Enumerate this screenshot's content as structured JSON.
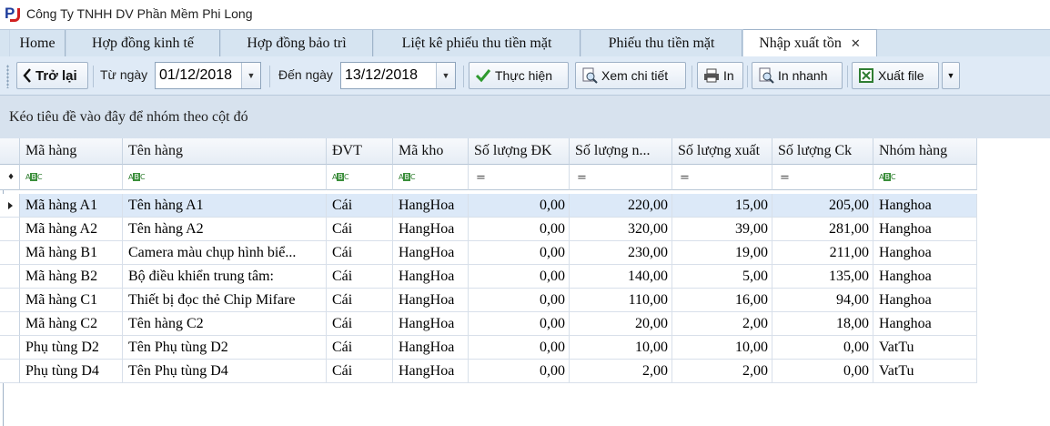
{
  "window": {
    "title": "Công Ty TNHH DV Phần Mềm Phi Long"
  },
  "tabs": [
    {
      "label": "Home"
    },
    {
      "label": "Hợp đồng kinh tế"
    },
    {
      "label": "Hợp đồng bảo trì"
    },
    {
      "label": "Liệt kê phiếu thu tiền mặt"
    },
    {
      "label": "Phiếu thu tiền mặt"
    },
    {
      "label": "Nhập xuất tồn",
      "active": true
    }
  ],
  "toolbar": {
    "back_label": "Trở lại",
    "from_label": "Từ ngày",
    "from_value": "01/12/2018",
    "to_label": "Đến ngày",
    "to_value": "13/12/2018",
    "execute_label": "Thực hiện",
    "detail_label": "Xem chi tiết",
    "print_label": "In",
    "quickprint_label": "In nhanh",
    "export_label": "Xuất file"
  },
  "group_panel": {
    "hint": "Kéo tiêu đề vào đây để nhóm theo cột đó"
  },
  "grid": {
    "columns": [
      "Mã hàng",
      "Tên hàng",
      "ĐVT",
      "Mã kho",
      "Số lượng ĐK",
      "Số lượng n...",
      "Số lượng xuất",
      "Số lượng Ck",
      "Nhóm hàng"
    ],
    "filter_glyphs": {
      "text": "ABC",
      "number": "="
    },
    "rows": [
      [
        "Mã hàng A1",
        "Tên hàng A1",
        "Cái",
        "HangHoa",
        "0,00",
        "220,00",
        "15,00",
        "205,00",
        "Hanghoa"
      ],
      [
        "Mã hàng A2",
        "Tên hàng A2",
        "Cái",
        "HangHoa",
        "0,00",
        "320,00",
        "39,00",
        "281,00",
        "Hanghoa"
      ],
      [
        "Mã hàng B1",
        "Camera màu chụp hình biể...",
        "Cái",
        "HangHoa",
        "0,00",
        "230,00",
        "19,00",
        "211,00",
        "Hanghoa"
      ],
      [
        "Mã hàng B2",
        "Bộ điều khiển trung tâm:",
        "Cái",
        "HangHoa",
        "0,00",
        "140,00",
        "5,00",
        "135,00",
        "Hanghoa"
      ],
      [
        "Mã hàng C1",
        "Thiết bị đọc thẻ Chip Mifare",
        "Cái",
        "HangHoa",
        "0,00",
        "110,00",
        "16,00",
        "94,00",
        "Hanghoa"
      ],
      [
        "Mã hàng C2",
        "Tên hàng C2",
        "Cái",
        "HangHoa",
        "0,00",
        "20,00",
        "2,00",
        "18,00",
        "Hanghoa"
      ],
      [
        "Phụ tùng D2",
        "Tên Phụ tùng D2",
        "Cái",
        "HangHoa",
        "0,00",
        "10,00",
        "10,00",
        "0,00",
        "VatTu"
      ],
      [
        "Phụ tùng D4",
        "Tên Phụ tùng D4",
        "Cái",
        "HangHoa",
        "0,00",
        "2,00",
        "2,00",
        "0,00",
        "VatTu"
      ]
    ]
  }
}
